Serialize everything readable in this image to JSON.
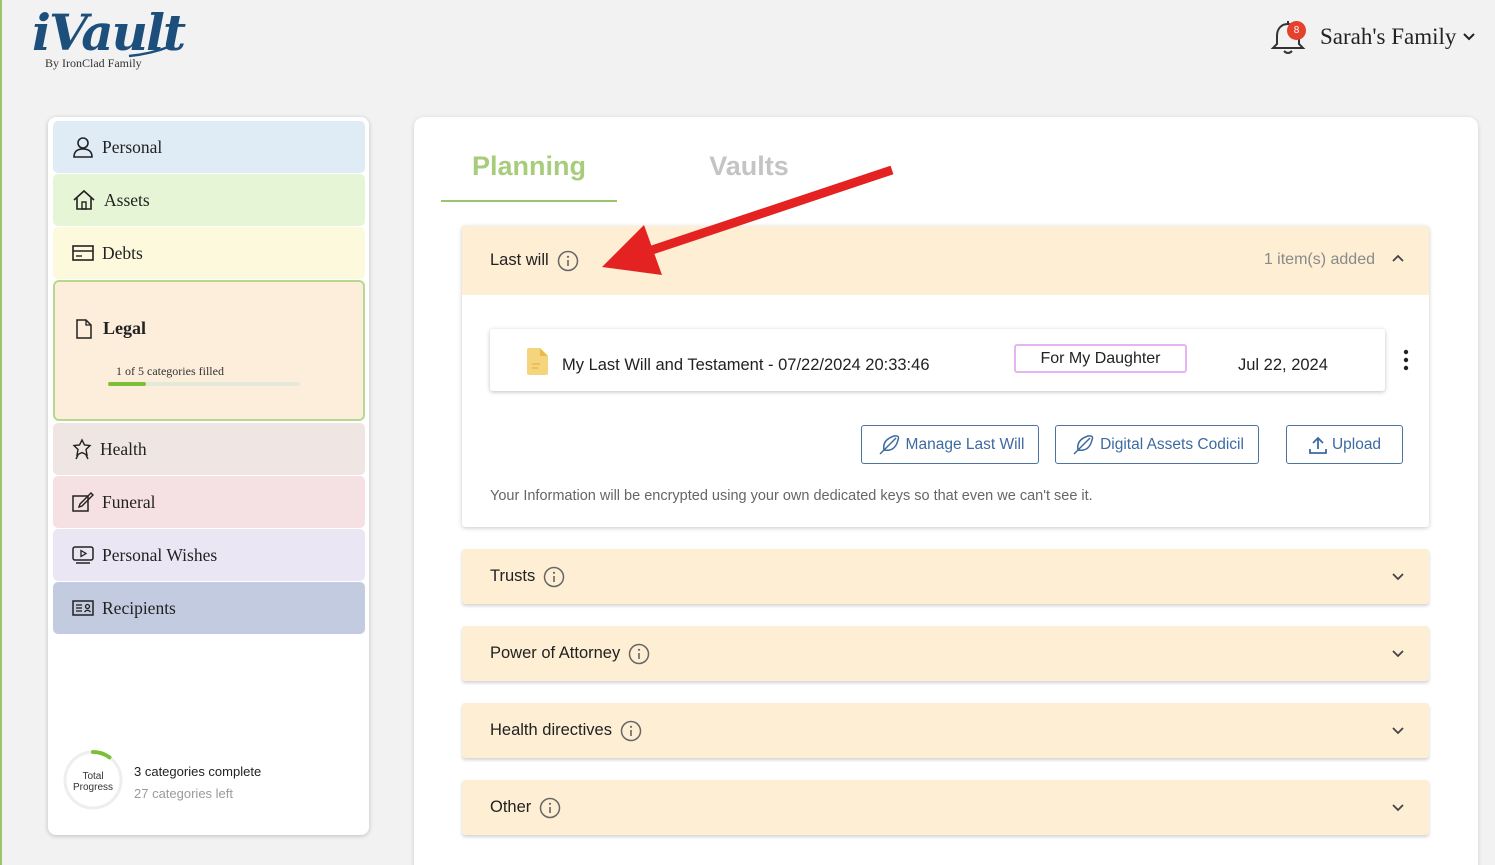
{
  "header": {
    "logo_text": "iVault",
    "logo_subtext": "By IronClad Family",
    "notification_count": "8",
    "family_name": "Sarah's Family"
  },
  "sidebar": {
    "items": [
      {
        "label": "Personal",
        "icon": "person-icon",
        "color": "#dfebf5"
      },
      {
        "label": "Assets",
        "icon": "house-icon",
        "color": "#e6f5d5"
      },
      {
        "label": "Debts",
        "icon": "credit-card-icon",
        "color": "#fdf9dc"
      },
      {
        "label": "Legal",
        "icon": "document-icon",
        "color": "#fdeedb"
      },
      {
        "label": "Health",
        "icon": "medal-icon",
        "color": "#efe6e3"
      },
      {
        "label": "Funeral",
        "icon": "edit-icon",
        "color": "#f5e0e4"
      },
      {
        "label": "Personal Wishes",
        "icon": "video-icon",
        "color": "#ebe6f3"
      },
      {
        "label": "Recipients",
        "icon": "id-card-icon",
        "color": "#c3cbe0"
      }
    ],
    "legal_progress_text": "1 of 5 categories filled",
    "legal_progress": 0.2,
    "total_progress_label": "Total Progress",
    "total_progress": 0.1,
    "categories_complete": "3 categories complete",
    "categories_left": "27 categories left"
  },
  "main": {
    "tabs": [
      "Planning",
      "Vaults"
    ],
    "active_tab": "Planning",
    "sections": [
      {
        "title": "Last will",
        "expanded": true,
        "status": "1 item(s) added"
      },
      {
        "title": "Trusts",
        "expanded": false
      },
      {
        "title": "Power of Attorney",
        "expanded": false
      },
      {
        "title": "Health directives",
        "expanded": false
      },
      {
        "title": "Other",
        "expanded": false
      }
    ],
    "document": {
      "name": "My Last Will and Testament - 07/22/2024 20:33:46",
      "tag": "For My Daughter",
      "date": "Jul 22, 2024"
    },
    "buttons": {
      "manage": "Manage Last Will",
      "codicil": "Digital Assets Codicil",
      "upload": "Upload"
    },
    "info_note": "Your Information will be encrypted using your own dedicated keys so that even we can't see it."
  },
  "colors": {
    "accent_green": "#9cc46a",
    "section_bg": "#fdeed4",
    "button_blue": "#3d6aa0",
    "annotation_red": "#e52222"
  }
}
